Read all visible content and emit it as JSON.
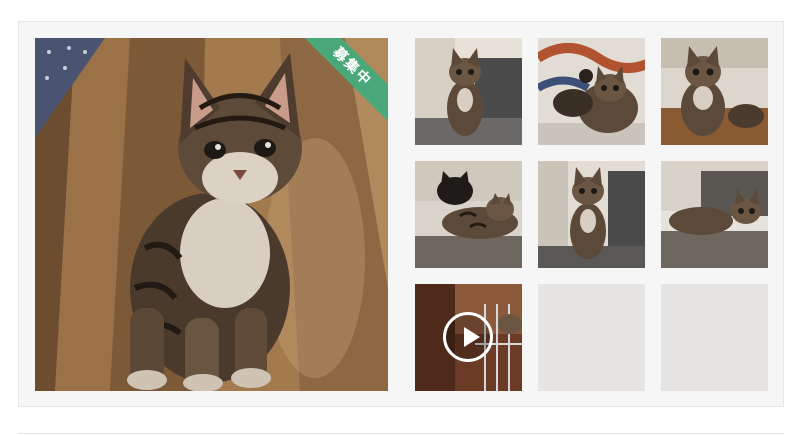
{
  "status_ribbon": {
    "label": "募集中",
    "color": "#4aa77a"
  },
  "main_photo": {
    "subject": "tabby-kitten-looking-up"
  },
  "gallery": {
    "thumbnails": [
      {
        "subject": "kitten-on-couch"
      },
      {
        "subject": "kittens-on-patterned-blanket"
      },
      {
        "subject": "kitten-on-scratcher"
      },
      {
        "subject": "kittens-sleeping"
      },
      {
        "subject": "kitten-sitting-on-couch"
      },
      {
        "subject": "kittens-lying-on-couch"
      },
      {
        "subject": "kitten-video",
        "type": "video"
      },
      {
        "subject": "empty"
      },
      {
        "subject": "empty"
      }
    ]
  }
}
